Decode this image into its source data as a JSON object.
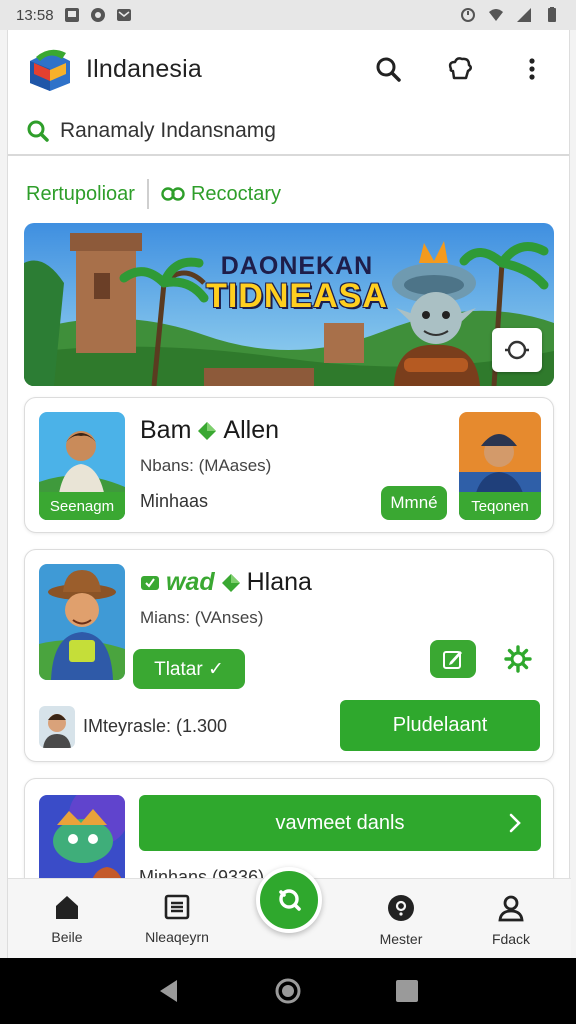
{
  "status_bar": {
    "time": "13:58"
  },
  "app": {
    "title": "Ilndanesia"
  },
  "search": {
    "query": "Ranamaly Indansnamg"
  },
  "tabs": [
    {
      "label": "Rertupolioar"
    },
    {
      "label": "Recoctary"
    }
  ],
  "banner": {
    "line1": "DAONEKAN",
    "line2": "TIDNEASA"
  },
  "card1": {
    "title_left": "Bam",
    "title_right": "Allen",
    "subtitle": "Nbans: (MAases)",
    "detail": "Minhaas",
    "thumb_left_label": "Seenagm",
    "pill_label": "Mmné",
    "thumb_right_label": "Teqonen"
  },
  "card2": {
    "title_left": "wad",
    "title_right": "Hlana",
    "subtitle": "Mians: (VAnses)",
    "badge_label": "Tlatar ✓",
    "price_text": "IMteyrasle: (1.300",
    "button_label": "Pludelaant"
  },
  "card3": {
    "button_label": "vavmeet danls",
    "subtitle": "Minhans (9336)"
  },
  "bottom_nav": [
    {
      "label": "Beile"
    },
    {
      "label": "Nleaqeyrn"
    },
    {
      "label": "Mester"
    },
    {
      "label": "Fdack"
    }
  ],
  "colors": {
    "accent": "#2fa82d",
    "accent_light": "#3aa832",
    "text": "#222222"
  }
}
